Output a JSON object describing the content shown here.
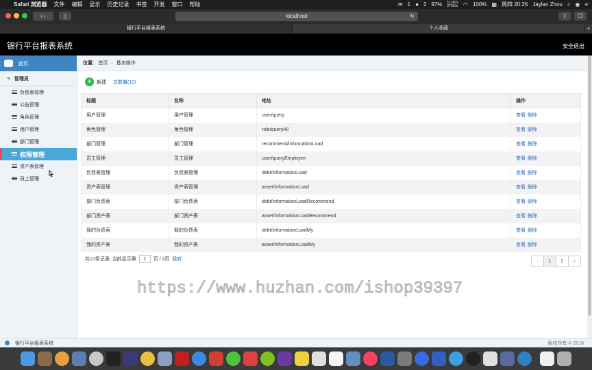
{
  "menubar": {
    "app": "Safari 浏览器",
    "items": [
      "文件",
      "编辑",
      "显示",
      "历史记录",
      "书签",
      "开发",
      "窗口",
      "帮助"
    ],
    "status": {
      "badge1": "1",
      "badge2": "2",
      "battery": "97%",
      "battery2": "100%",
      "net_up": "11.6K/s",
      "net_down": "275K/s",
      "clock": "周四 20:26",
      "user": "Jaylan Zhou"
    }
  },
  "browser": {
    "url": "localhost",
    "tabs": [
      "银行平台报表系统",
      "个人收藏"
    ],
    "new_tab": "+"
  },
  "app": {
    "title": "银行平台报表系统",
    "logout": "安全退出"
  },
  "sidebar": {
    "home": "首页",
    "group": "管理员",
    "items": [
      "负债表管理",
      "公告管理",
      "角色管理",
      "用户管理",
      "部门管理",
      "权限管理",
      "资产表管理",
      "员工管理"
    ],
    "active_index": 5
  },
  "breadcrumb": {
    "label": "位置:",
    "items": [
      "首页",
      "基本操作"
    ]
  },
  "actions": {
    "new": "新建",
    "total": "总数量(12)"
  },
  "table": {
    "headers": [
      "标题",
      "名称",
      "地址",
      "操作"
    ],
    "rows": [
      [
        "用户管理",
        "用户管理",
        "user/query"
      ],
      [
        "角色管理",
        "角色管理",
        "role/queryAll"
      ],
      [
        "部门管理",
        "部门管理",
        "recommend/informationLoad"
      ],
      [
        "员工管理",
        "员工管理",
        "user/queryEmployee"
      ],
      [
        "负债表管理",
        "负债表管理",
        "debt/informationLoad"
      ],
      [
        "资产表管理",
        "资产表管理",
        "asset/informationLoad"
      ],
      [
        "部门负债表",
        "部门负债表",
        "debt/informationLoadRecommend"
      ],
      [
        "部门资产表",
        "部门资产表",
        "asset/informationLoadRecommend"
      ],
      [
        "我的负债表",
        "我的负债表",
        "debt/informationLoadMy"
      ],
      [
        "我的资产表",
        "我的资产表",
        "asset/informationLoadMy"
      ]
    ],
    "view_label": "查看",
    "delete_label": "删除"
  },
  "pager": {
    "prefix": "共",
    "count": "12",
    "mid": "条记录,  当前显示第",
    "page": "1",
    "suffix": "页 / 2页",
    "jump": "跳转"
  },
  "pagination": {
    "prev": "‹",
    "pages": [
      "1",
      "2"
    ],
    "next": "›"
  },
  "watermark": "https://www.huzhan.com/ishop39397",
  "statusbar": {
    "text": "银行平台报表系统",
    "copyright": "版权所有 © 2018"
  },
  "colors": {
    "sidebar_active": "#4aa7d8",
    "header": "#000000",
    "link": "#2a6ebb",
    "home": "#3f85c2"
  }
}
